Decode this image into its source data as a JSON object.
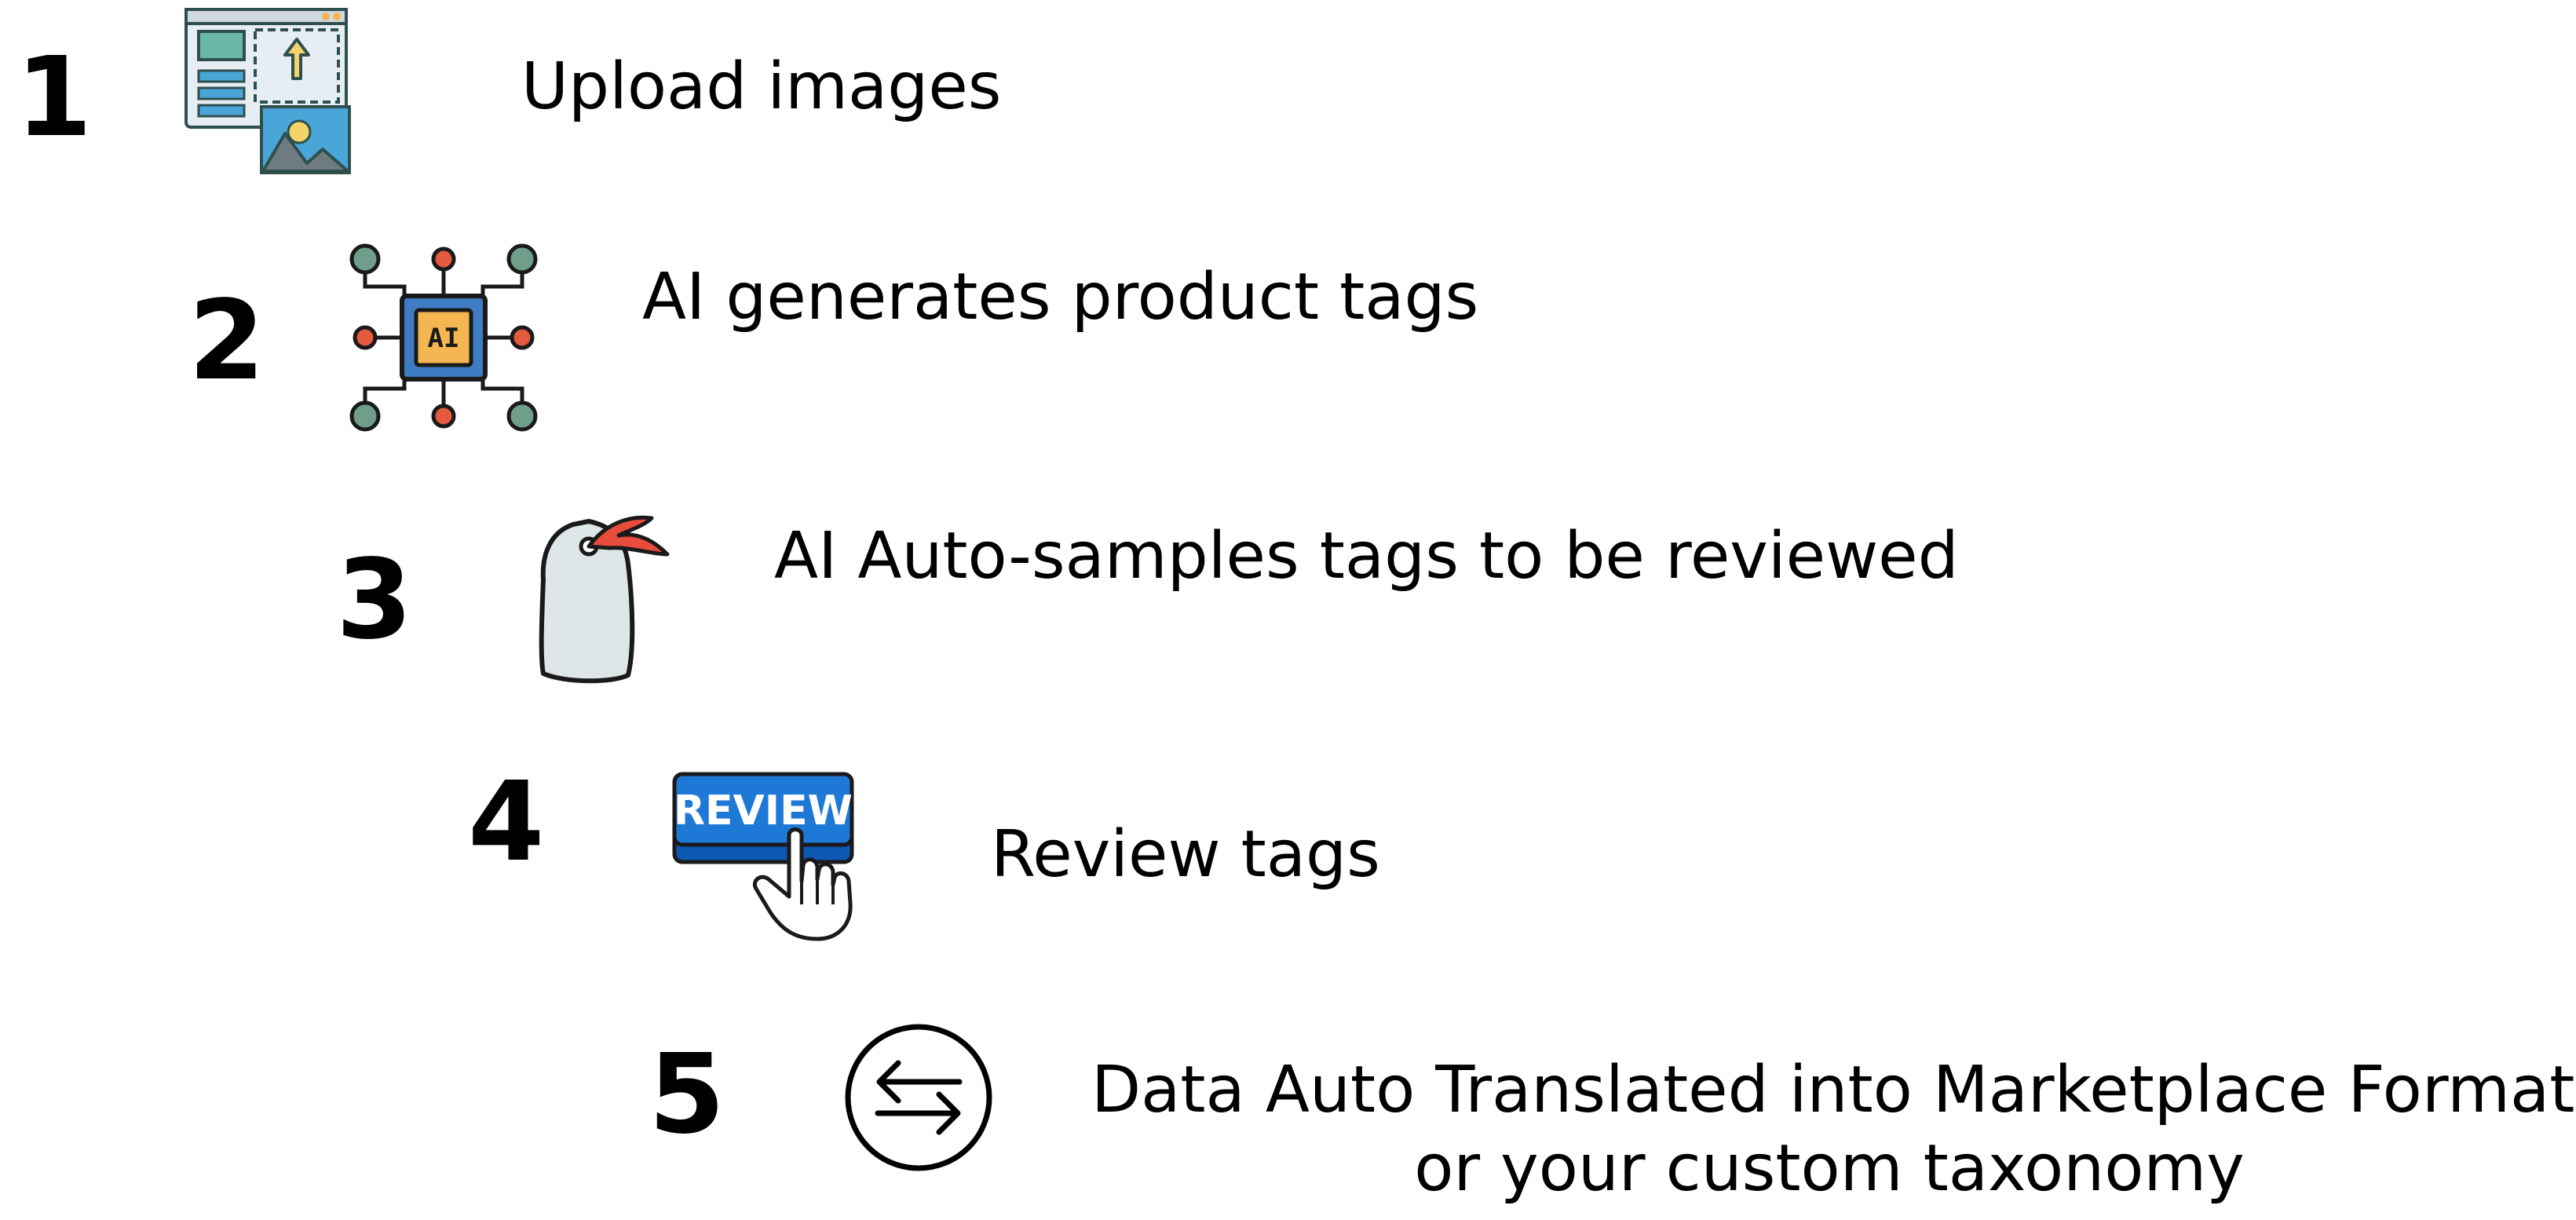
{
  "steps": [
    {
      "number": "1",
      "label": "Upload images",
      "icon": "image-upload-icon"
    },
    {
      "number": "2",
      "label": "AI generates product tags",
      "icon": "ai-chip-icon",
      "icon_text": "AI"
    },
    {
      "number": "3",
      "label": "AI Auto-samples tags to be reviewed",
      "icon": "price-tag-icon"
    },
    {
      "number": "4",
      "label": "Review tags",
      "icon": "review-button-icon",
      "icon_text": "REVIEW"
    },
    {
      "number": "5",
      "label_line1": "Data Auto Translated into Marketplace Format",
      "label_line2": "or your custom taxonomy",
      "icon": "transfer-arrows-icon"
    }
  ],
  "colors": {
    "text": "#000000",
    "panel_light": "#e7eef3",
    "panel_blue": "#4aa6d8",
    "panel_green": "#6bb7a6",
    "chip_yellow": "#f4b650",
    "chip_blue": "#3f7cc3",
    "node_green": "#6f9f8b",
    "node_red": "#e35a3f",
    "tag_gray": "#dfe6e8",
    "tag_red": "#e74c3c",
    "button_blue": "#1e78d6",
    "button_dark": "#0f58b1"
  }
}
